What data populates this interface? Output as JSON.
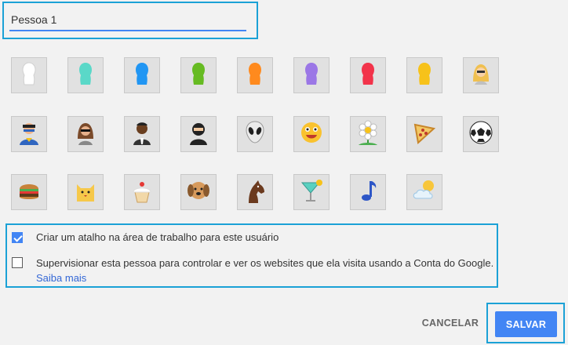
{
  "profile": {
    "name_value": "Pessoa 1"
  },
  "avatars": [
    {
      "icon": "white-silhouette-icon",
      "color": "#ffffff"
    },
    {
      "icon": "teal-silhouette-icon",
      "color": "#5ad8c8"
    },
    {
      "icon": "blue-silhouette-icon",
      "color": "#2196f3"
    },
    {
      "icon": "green-silhouette-icon",
      "color": "#66bb22"
    },
    {
      "icon": "orange-silhouette-icon",
      "color": "#ff8a1e"
    },
    {
      "icon": "purple-silhouette-icon",
      "color": "#9b77e6"
    },
    {
      "icon": "red-silhouette-icon",
      "color": "#f2334a"
    },
    {
      "icon": "yellow-silhouette-icon",
      "color": "#f7c21a"
    },
    {
      "icon": "blonde-woman-icon",
      "color": "#f0c050"
    },
    {
      "icon": "superhero-icon",
      "color": "#3066c0"
    },
    {
      "icon": "woman-sunglasses-icon",
      "color": "#7a4a2a"
    },
    {
      "icon": "businessman-icon",
      "color": "#6a3f20"
    },
    {
      "icon": "ninja-icon",
      "color": "#222222"
    },
    {
      "icon": "alien-icon",
      "color": "#ececec"
    },
    {
      "icon": "smiley-face-icon",
      "color": "#f9c22e"
    },
    {
      "icon": "flower-icon",
      "color": "#ffffff"
    },
    {
      "icon": "pizza-icon",
      "color": "#f3c864"
    },
    {
      "icon": "soccer-ball-icon",
      "color": "#ffffff"
    },
    {
      "icon": "burger-icon",
      "color": "#c8823a"
    },
    {
      "icon": "cat-icon",
      "color": "#f6c84a"
    },
    {
      "icon": "cupcake-icon",
      "color": "#f2d8a8"
    },
    {
      "icon": "dog-icon",
      "color": "#d79a5c"
    },
    {
      "icon": "horse-icon",
      "color": "#6b3a1e"
    },
    {
      "icon": "cocktail-icon",
      "color": "#5ad0c0"
    },
    {
      "icon": "music-note-icon",
      "color": "#2d56c7"
    },
    {
      "icon": "sun-cloud-icon",
      "color": "#f8c63b"
    }
  ],
  "options": {
    "shortcut": {
      "label": "Criar um atalho na área de trabalho para este usuário",
      "checked": true
    },
    "supervise": {
      "label": "Supervisionar esta pessoa para controlar e ver os websites que ela visita usando a Conta do Google.",
      "checked": false,
      "link": "Saiba mais"
    }
  },
  "actions": {
    "cancel_label": "CANCELAR",
    "save_label": "SALVAR"
  },
  "colors": {
    "accent": "#4285f4",
    "highlight_border": "#1ba1d6",
    "link": "#3367d6"
  }
}
